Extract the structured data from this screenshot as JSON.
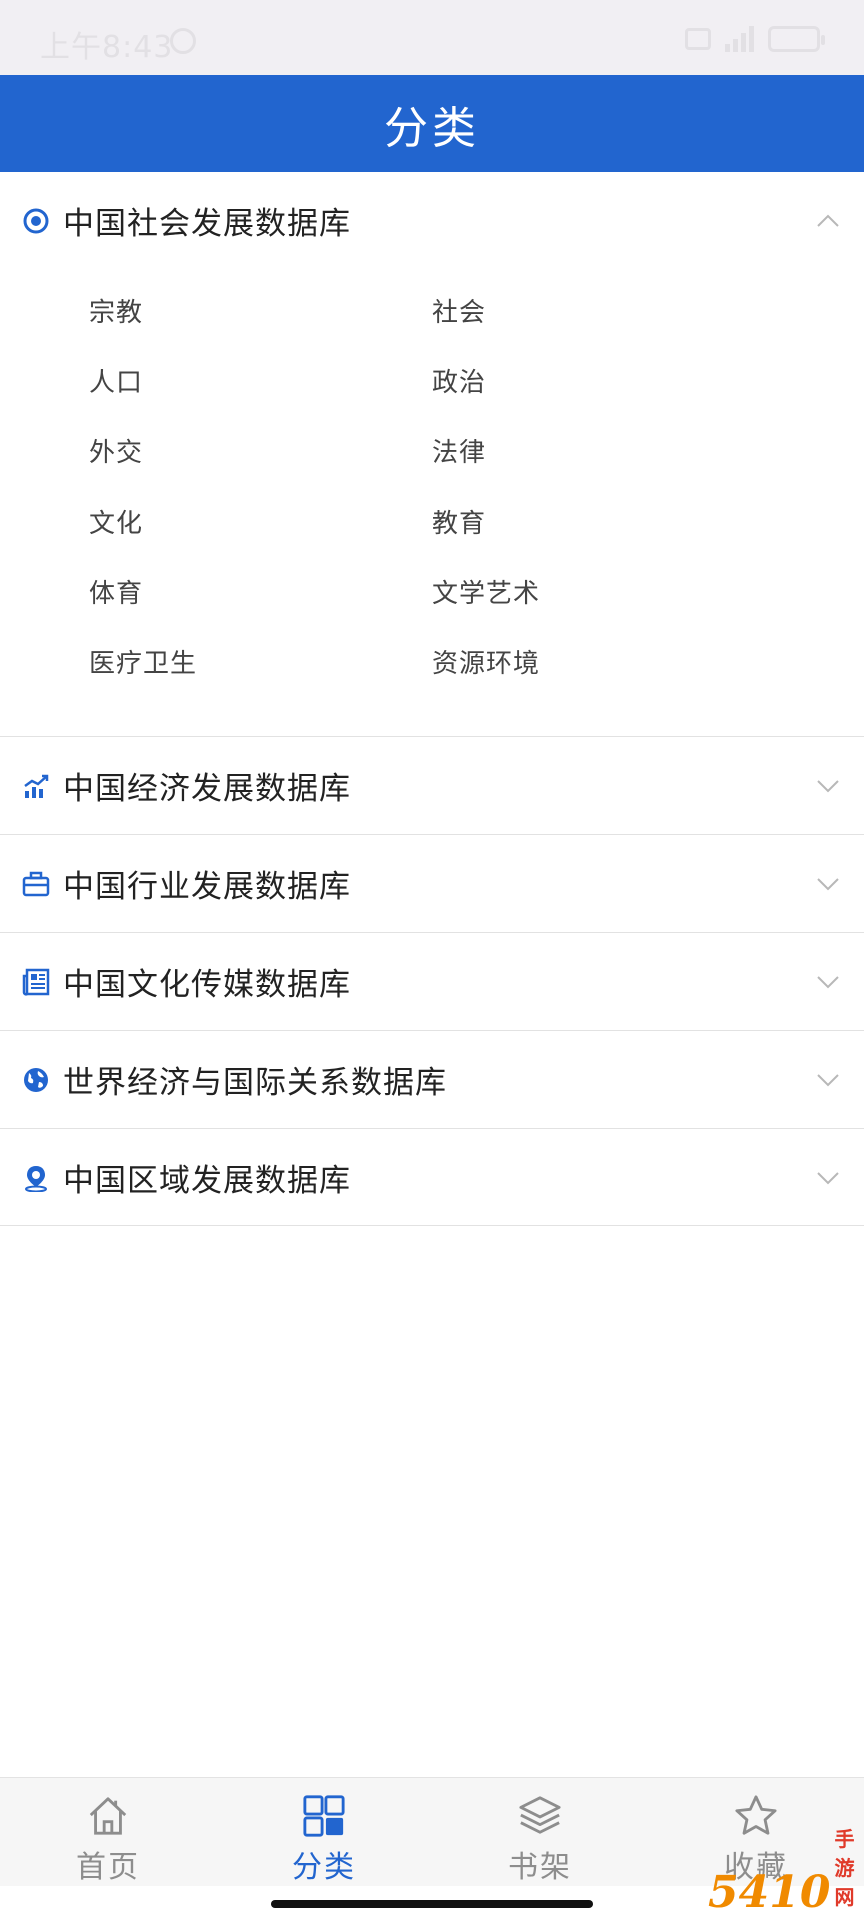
{
  "status_bar": {
    "time": "上午8:43"
  },
  "header": {
    "title": "分类"
  },
  "sections": [
    {
      "title": "中国社会发展数据库",
      "icon": "target-icon",
      "expanded": true,
      "items": [
        "宗教",
        "社会",
        "人口",
        "政治",
        "外交",
        "法律",
        "文化",
        "教育",
        "体育",
        "文学艺术",
        "医疗卫生",
        "资源环境"
      ]
    },
    {
      "title": "中国经济发展数据库",
      "icon": "chart-trend-icon",
      "expanded": false
    },
    {
      "title": "中国行业发展数据库",
      "icon": "briefcase-icon",
      "expanded": false
    },
    {
      "title": "中国文化传媒数据库",
      "icon": "newspaper-icon",
      "expanded": false
    },
    {
      "title": "世界经济与国际关系数据库",
      "icon": "globe-icon",
      "expanded": false
    },
    {
      "title": "中国区域发展数据库",
      "icon": "location-pin-icon",
      "expanded": false
    }
  ],
  "tabbar": {
    "tabs": [
      {
        "label": "首页",
        "icon": "home-icon"
      },
      {
        "label": "分类",
        "icon": "grid-icon",
        "active": true
      },
      {
        "label": "书架",
        "icon": "layers-icon"
      },
      {
        "label": "收藏",
        "icon": "star-icon"
      }
    ]
  },
  "watermark": {
    "number": "5410",
    "text": "手游网"
  },
  "colors": {
    "primary": "#2265cf",
    "inactive": "#8d8d8d"
  }
}
